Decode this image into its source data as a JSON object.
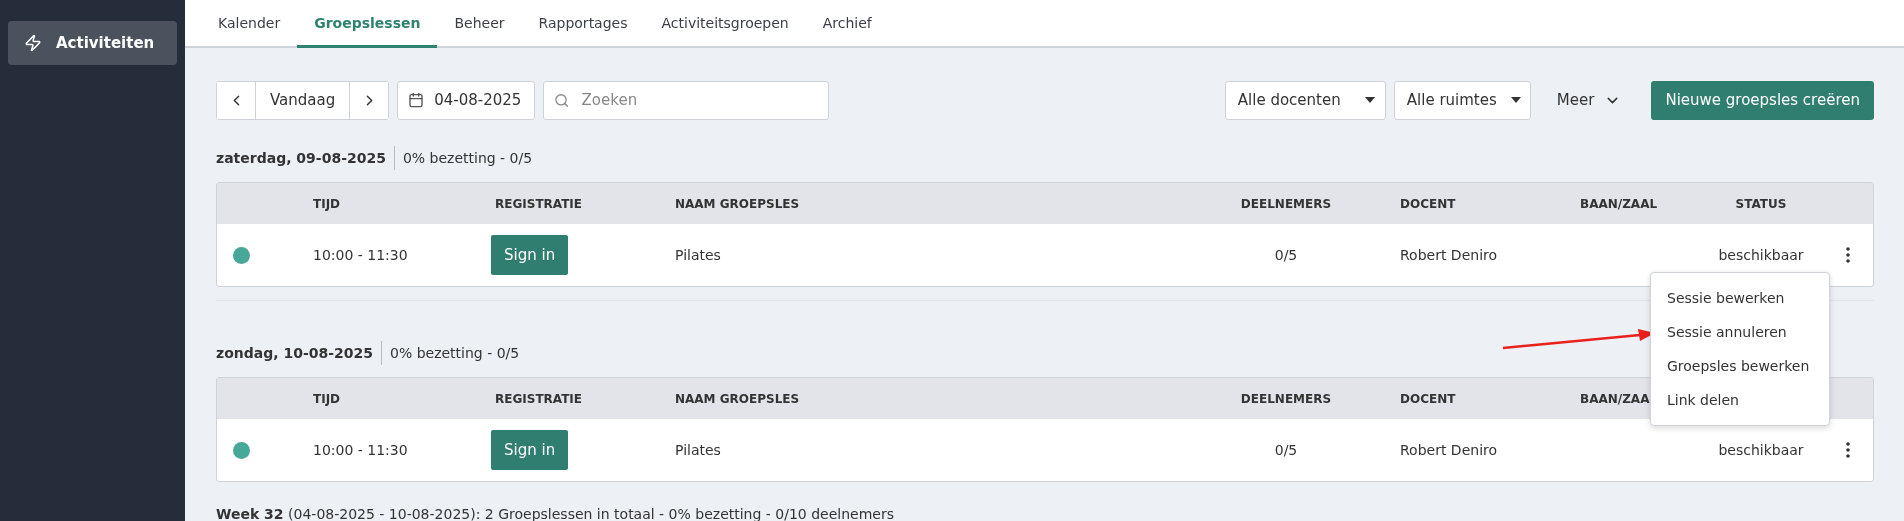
{
  "sidebar": {
    "items": [
      {
        "label": "Activiteiten",
        "selected": true
      }
    ]
  },
  "tabs": [
    {
      "label": "Kalender",
      "selected": false
    },
    {
      "label": "Groepslessen",
      "selected": true
    },
    {
      "label": "Beheer",
      "selected": false
    },
    {
      "label": "Rapportages",
      "selected": false
    },
    {
      "label": "Activiteitsgroepen",
      "selected": false
    },
    {
      "label": "Archief",
      "selected": false
    }
  ],
  "toolbar": {
    "today": "Vandaag",
    "date": "04-08-2025",
    "search": {
      "placeholder": "Zoeken"
    },
    "teacher_filter": "Alle docenten",
    "room_filter": "Alle ruimtes",
    "more": "Meer",
    "create_button": "Nieuwe groepsles creëren"
  },
  "days": [
    {
      "date": "zaterdag, 09-08-2025",
      "summary": "0% bezetting - 0/5",
      "columns": [
        "TIJD",
        "REGISTRATIE",
        "NAAM GROEPSLES",
        "DEELNEMERS",
        "DOCENT",
        "BAAN/ZAAL",
        "STATUS"
      ],
      "sessions": [
        {
          "color": "#47a898",
          "time": "10:00 - 11:30",
          "action": "Sign in",
          "name": "Pilates",
          "participants": "0/5",
          "teacher": "Robert Deniro",
          "status": "beschikbaar"
        }
      ]
    },
    {
      "date": "zondag, 10-08-2025",
      "summary": "0% bezetting - 0/5",
      "columns": [
        "TIJD",
        "REGISTRATIE",
        "NAAM GROEPSLES",
        "DEELNEMERS",
        "DOCENT",
        "BAAN/ZAA"
      ],
      "sessions": [
        {
          "color": "#47a898",
          "time": "10:00 - 11:30",
          "action": "Sign in",
          "name": "Pilates",
          "participants": "0/5",
          "teacher": "Robert Deniro",
          "status": "beschikbaar"
        }
      ]
    }
  ],
  "context_menu": {
    "items": [
      "Sessie bewerken",
      "Sessie annuleren",
      "Groepsles bewerken",
      "Link delen"
    ]
  },
  "week_summary": "**Week 32** (04-08-2025 - 10-08-2025): 2 Groepslessen in totaal  - 0% bezetting  -  0/10 deelnemers"
}
